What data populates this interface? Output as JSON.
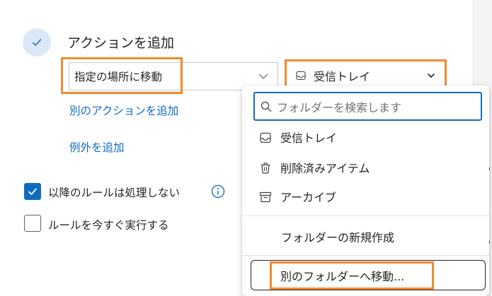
{
  "rule_action": {
    "section_title": "アクションを追加",
    "action_select": {
      "value": "指定の場所に移動"
    },
    "folder_select": {
      "value": "受信トレイ",
      "icon": "inbox-icon"
    },
    "add_another_action": "別のアクションを追加",
    "add_exception": "例外を追加"
  },
  "options": {
    "stop_processing": {
      "label": "以降のルールは処理しない",
      "checked": true
    },
    "run_now": {
      "label": "ルールを今すぐ実行する",
      "checked": false
    }
  },
  "folder_dropdown": {
    "search_placeholder": "フォルダーを検索します",
    "items": [
      {
        "label": "受信トレイ",
        "icon": "inbox-icon"
      },
      {
        "label": "削除済みアイテム",
        "icon": "trash-icon"
      },
      {
        "label": "アーカイブ",
        "icon": "archive-icon"
      }
    ],
    "new_folder": "フォルダーの新規作成",
    "move_to_other": "別のフォルダーへ移動..."
  },
  "colors": {
    "accent": "#0f6cbd",
    "highlight": "#f28a2e",
    "check_circle_bg": "#dbe8f7"
  }
}
